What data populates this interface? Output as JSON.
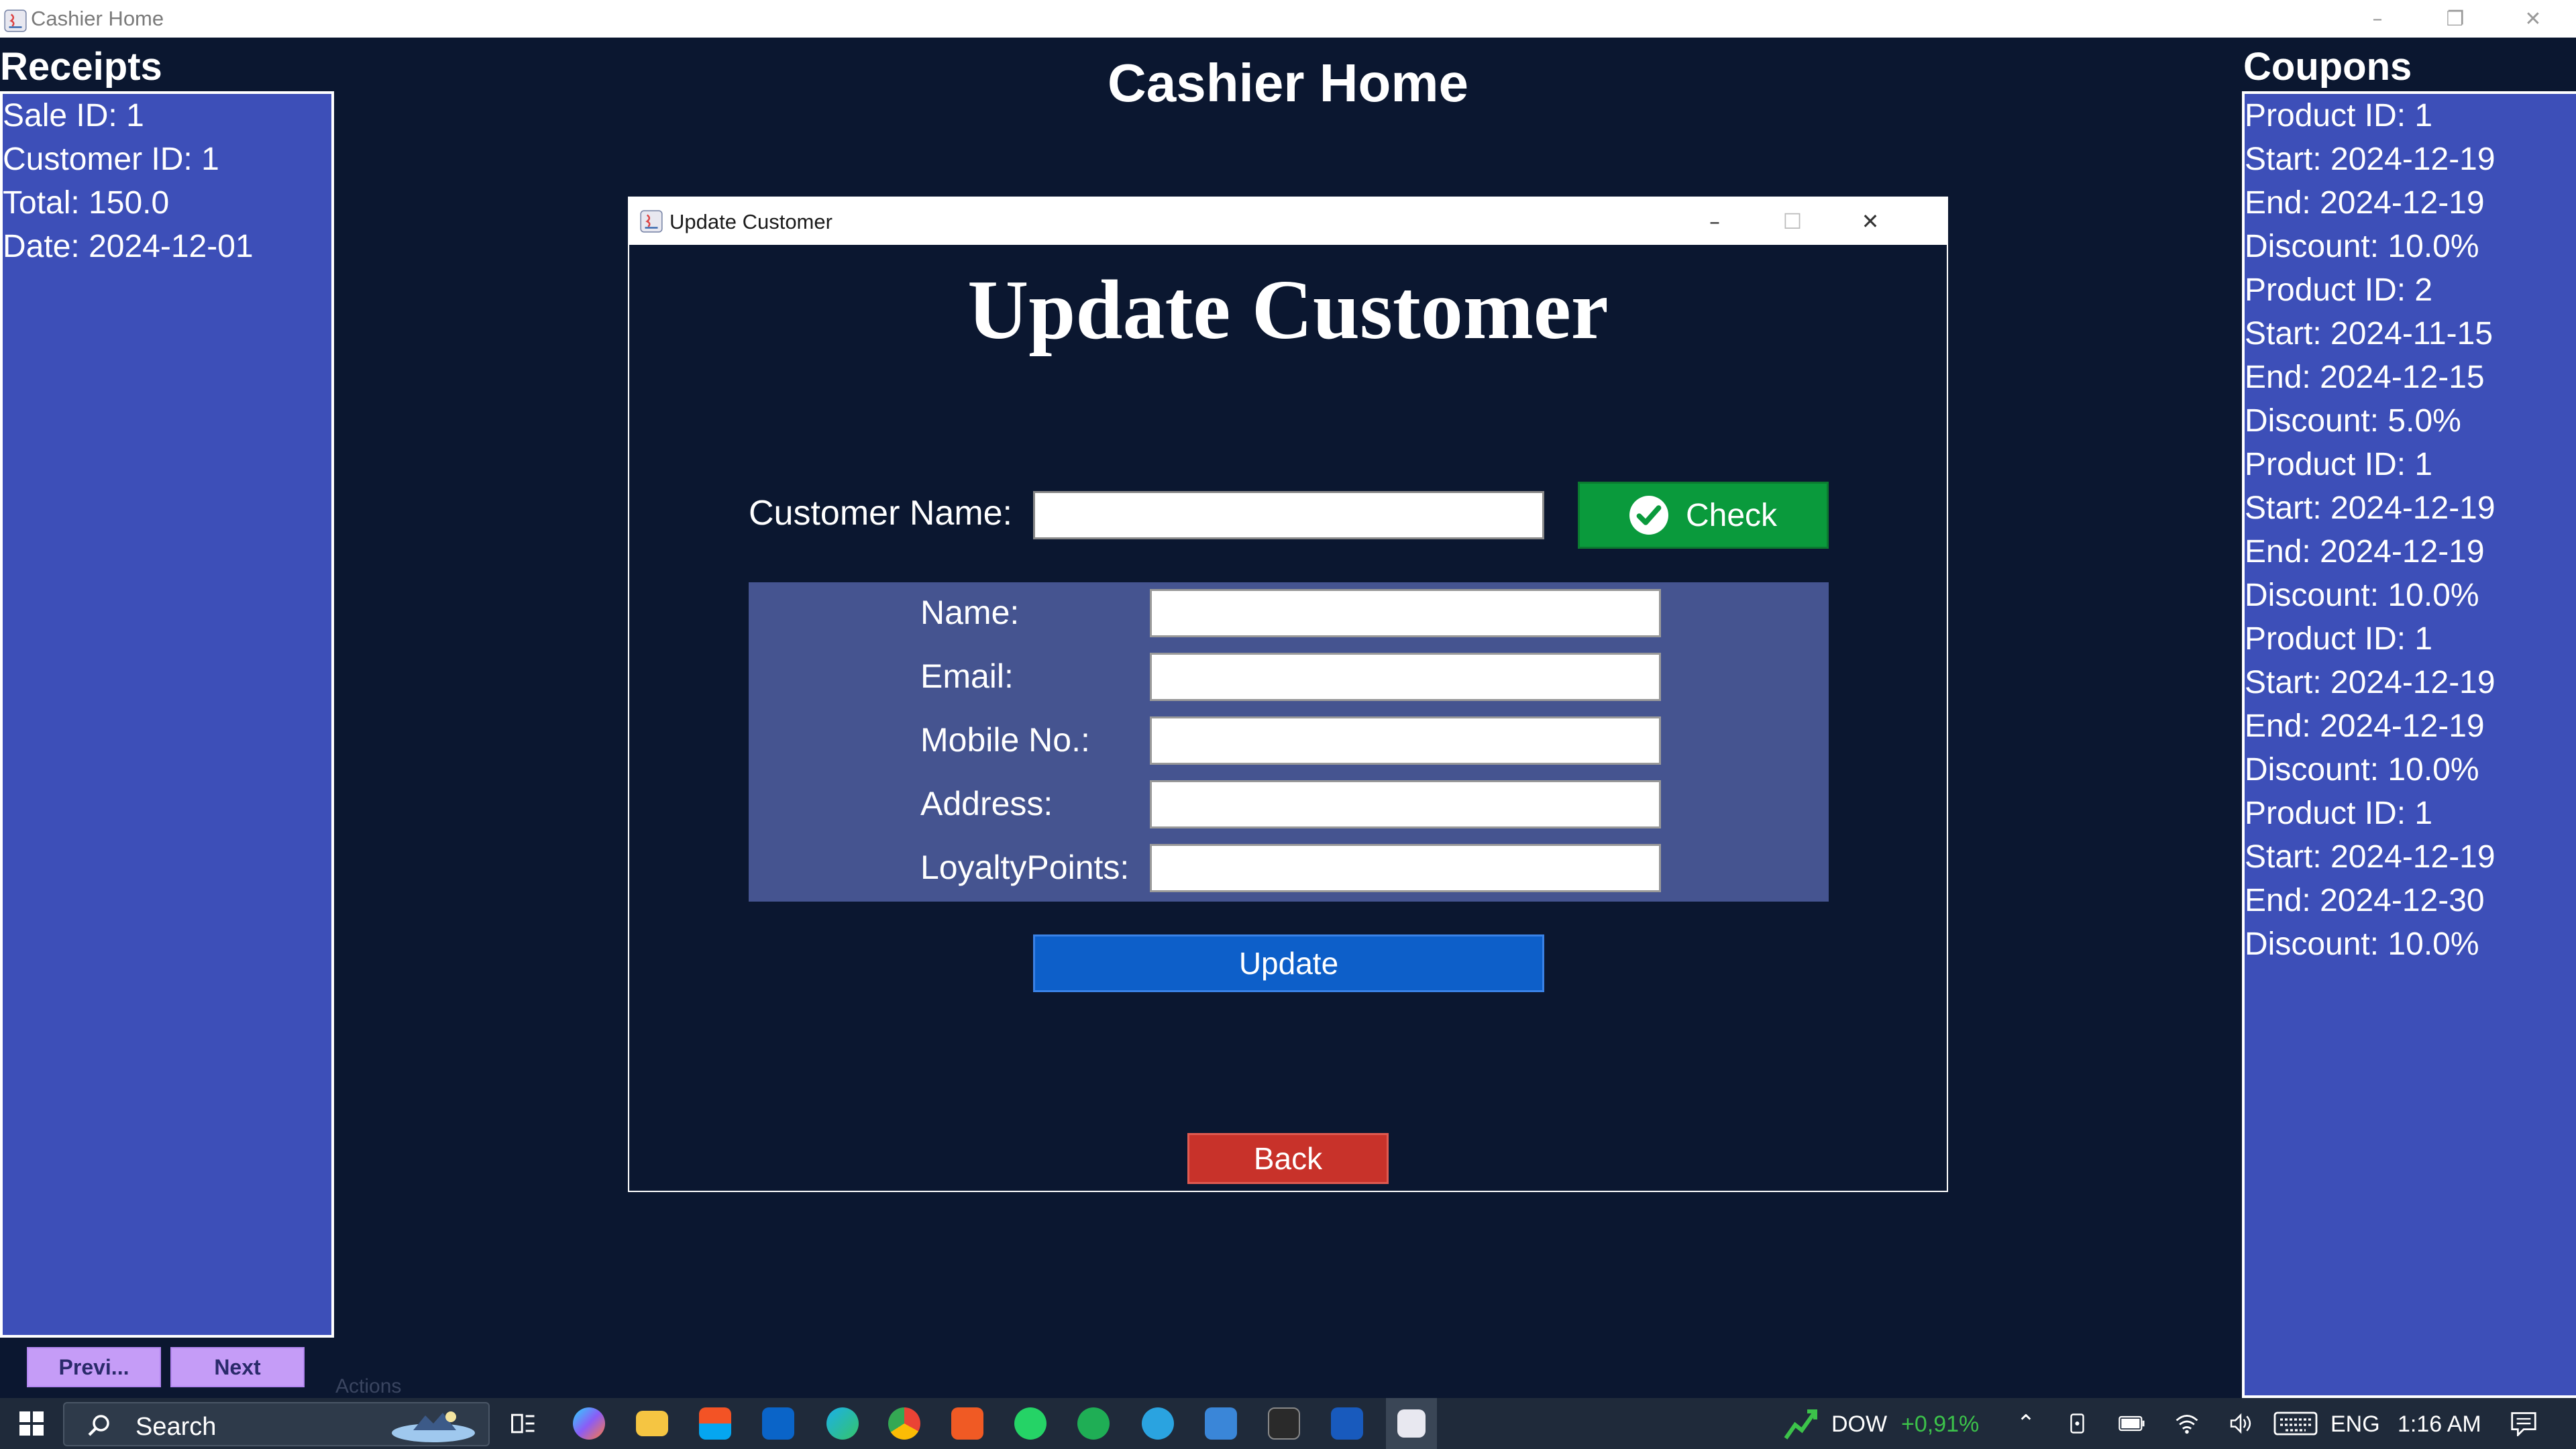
{
  "main_window": {
    "title": "Cashier Home",
    "page_title": "Cashier Home"
  },
  "receipts": {
    "heading": "Receipts",
    "lines": [
      "Sale ID: 1",
      "Customer ID: 1",
      "Total: 150.0",
      "Date: 2024-12-01"
    ],
    "prev_label": "Previ...",
    "next_label": "Next",
    "actions_label": "Actions"
  },
  "coupons": {
    "heading": "Coupons",
    "lines": [
      "Product ID: 1",
      "Start: 2024-12-19",
      "End: 2024-12-19",
      "Discount: 10.0%",
      "Product ID: 2",
      "Start: 2024-11-15",
      "End: 2024-12-15",
      "Discount: 5.0%",
      "Product ID: 1",
      "Start: 2024-12-19",
      "End: 2024-12-19",
      "Discount: 10.0%",
      "Product ID: 1",
      "Start: 2024-12-19",
      "End: 2024-12-19",
      "Discount: 10.0%",
      "Product ID: 1",
      "Start: 2024-12-19",
      "End: 2024-12-30",
      "Discount: 10.0%"
    ]
  },
  "dialog": {
    "window_title": "Update Customer",
    "heading": "Update Customer",
    "customer_name_label": "Customer Name:",
    "customer_name_value": "",
    "check_label": "Check",
    "fields": [
      {
        "label": "Name:",
        "value": ""
      },
      {
        "label": "Email:",
        "value": ""
      },
      {
        "label": "Mobile No.:",
        "value": ""
      },
      {
        "label": "Address:",
        "value": ""
      },
      {
        "label": "LoyaltyPoints:",
        "value": ""
      }
    ],
    "update_label": "Update",
    "back_label": "Back"
  },
  "taskbar": {
    "search_label": "Search",
    "ticker_name": "DOW",
    "ticker_change": "+0,91%",
    "language": "ENG",
    "time": "1:16 AM"
  },
  "colors": {
    "background": "#0b1730",
    "panel": "#3d4fb8",
    "form_box": "#455490",
    "check_green": "#0a9a3c",
    "update_blue": "#0d5fc9",
    "back_red": "#c8322a",
    "nav_purple": "#c59cf7"
  }
}
